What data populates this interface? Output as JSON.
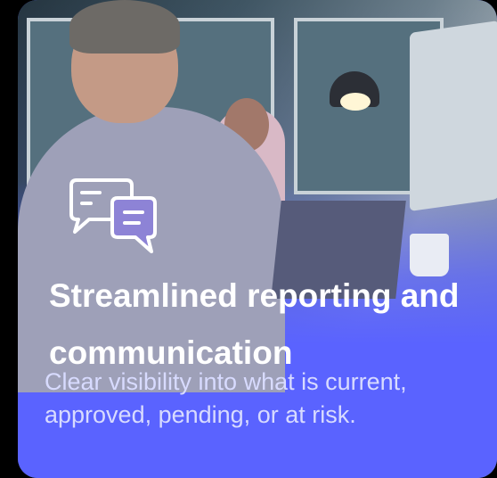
{
  "card": {
    "title": "Streamlined reporting and communication",
    "description": "Clear visibility into what is current, approved, pending, or at risk.",
    "icon": "chat-bubbles-icon",
    "accent_color": "#5a63ff"
  }
}
